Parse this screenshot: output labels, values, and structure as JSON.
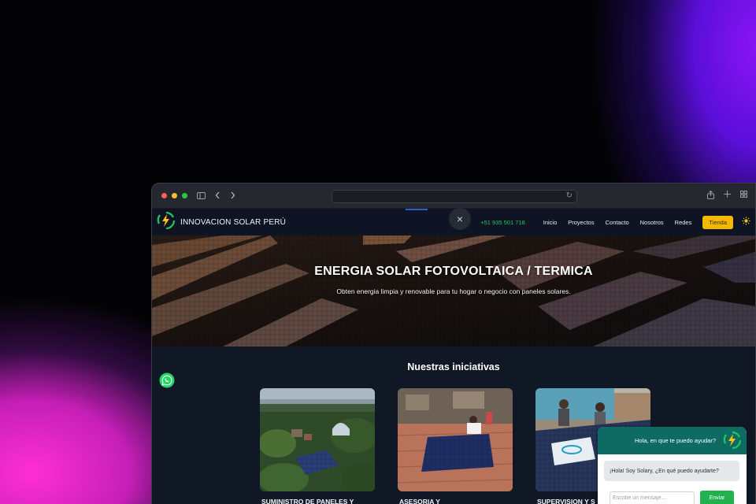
{
  "browser": {
    "url": "",
    "colors": {
      "close": "#ff5f57",
      "minimize": "#febc2e",
      "maximize": "#28c840"
    },
    "icons": [
      "sidebar-icon",
      "back-icon",
      "forward-icon",
      "reload-icon",
      "share-icon",
      "new-tab-icon",
      "tabs-overview-icon"
    ]
  },
  "nav": {
    "brand": "INNOVACION SOLAR PERÚ",
    "phone": "+51 935 501 718",
    "links": [
      "Inicio",
      "Proyectos",
      "Contacto",
      "Nosotros",
      "Redes"
    ],
    "shop": "Tienda",
    "close_symbol": "×",
    "theme_icon": "sun-icon",
    "accent": "#f5b800"
  },
  "hero": {
    "title": "ENERGIA SOLAR FOTOVOLTAICA / TERMICA",
    "subtitle": "Obten energia limpia y renovable para tu hogar o negocio con paneles solares."
  },
  "initiatives": {
    "title": "Nuestras iniciativas",
    "cards": [
      {
        "title": "SUMINISTRO DE PANELES Y"
      },
      {
        "title": "ASESORIA Y"
      },
      {
        "title": "SUPERVISION Y S"
      }
    ]
  },
  "chat": {
    "header": "Hola, en que te puedo ayudar?",
    "message": "¡Hola! Soy Solary, ¿En qué puedo ayudarte?",
    "input_placeholder": "Escribe un mensaje...",
    "send": "Enviar",
    "header_color": "#0d6b63",
    "send_color": "#21b14f"
  },
  "whatsapp": {
    "icon": "whatsapp-icon",
    "color": "#25d366"
  }
}
